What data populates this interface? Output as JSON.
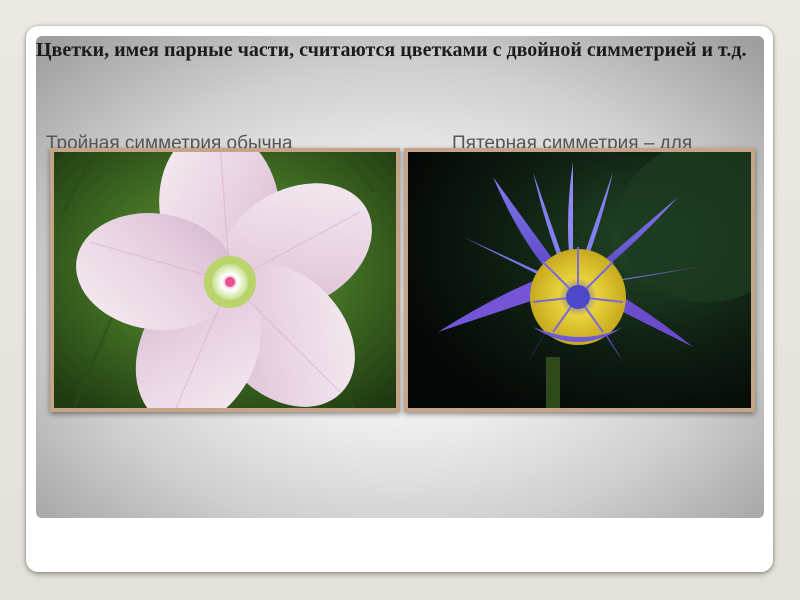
{
  "slide": {
    "title": "Цветки, имея парные части, считаются цветками с двойной симметрией и т.д.",
    "caption_left": "Тройная симметрия обычна",
    "caption_right": "Пятерная симметрия – для"
  },
  "images": [
    {
      "name": "pink-mallow-flower-photo",
      "subject": "pale pink five-petal flower on green background"
    },
    {
      "name": "blue-water-lily-photo",
      "subject": "violet-blue water lily on dark background"
    }
  ],
  "colors": {
    "frame": "#c4a58a",
    "title_text": "#1b1b1b",
    "caption_text": "#555555"
  }
}
